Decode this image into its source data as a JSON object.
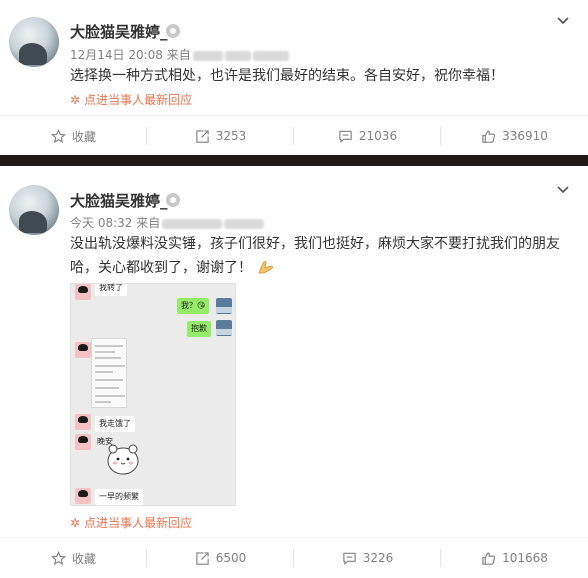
{
  "posts": [
    {
      "username": "大脸猫吴雅婷_",
      "timestamp": "12月14日 20:08",
      "source_prefix": "来自",
      "text": "选择换一种方式相处，也许是我们最好的结束。各自安好，祝你幸福！",
      "reply_link": "点进当事人最新回应",
      "actions": {
        "favorite": "收藏",
        "repost": "3253",
        "comment": "21036",
        "like": "336910"
      }
    },
    {
      "username": "大脸猫吴雅婷_",
      "timestamp": "今天 08:32",
      "source_prefix": "来自",
      "text_line1": "没出轨没爆料没实锤，孩子们很好，我们也挺好，麻烦大家不要打扰我们的朋友",
      "text_line2": "哈，关心都收到了，谢谢了！",
      "chat": {
        "msg_top": "我转了",
        "msg_green1": "我？😘",
        "msg_green2": "抱歉",
        "msg_white1": "我走饿了",
        "msg_white2": "晚安",
        "msg_white3": "一早的频繁"
      },
      "reply_link": "点进当事人最新回应",
      "actions": {
        "favorite": "收藏",
        "repost": "6500",
        "comment": "3226",
        "like": "101668"
      }
    }
  ],
  "colors": {
    "accent": "#eb7350",
    "divider": "#1f1a17",
    "meta": "#808080"
  },
  "icons": {
    "favorite": "star-icon",
    "repost": "repost-icon",
    "comment": "comment-icon",
    "like": "thumbs-up-icon",
    "menu": "chevron-down-icon"
  }
}
